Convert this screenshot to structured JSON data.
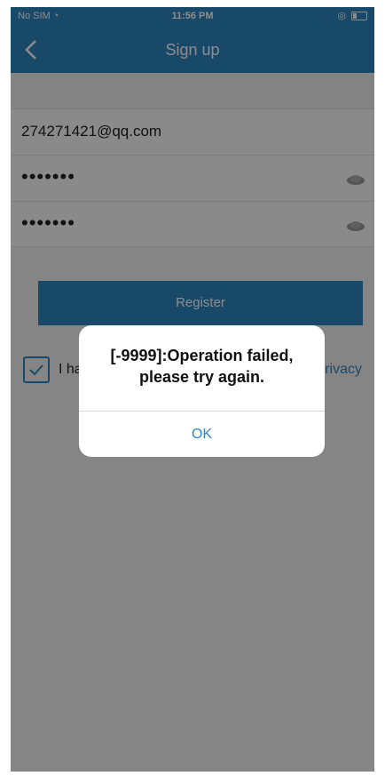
{
  "status_bar": {
    "carrier": "No SIM",
    "time": "11:56 PM"
  },
  "nav": {
    "title": "Sign up"
  },
  "form": {
    "email_value": "274271421@qq.com",
    "password_mask": "•••••••",
    "confirm_mask": "•••••••",
    "register_label": "Register"
  },
  "agreement": {
    "text_visible": "I ha",
    "privacy_fragment": "rivacy",
    "checked": true
  },
  "dialog": {
    "message_line1": "[-9999]:Operation failed,",
    "message_line2": "please try again.",
    "ok_label": "OK"
  },
  "colors": {
    "accent": "#2f86bf",
    "background": "#f2f2f2",
    "overlay": "rgba(0,0,0,0.45)"
  }
}
